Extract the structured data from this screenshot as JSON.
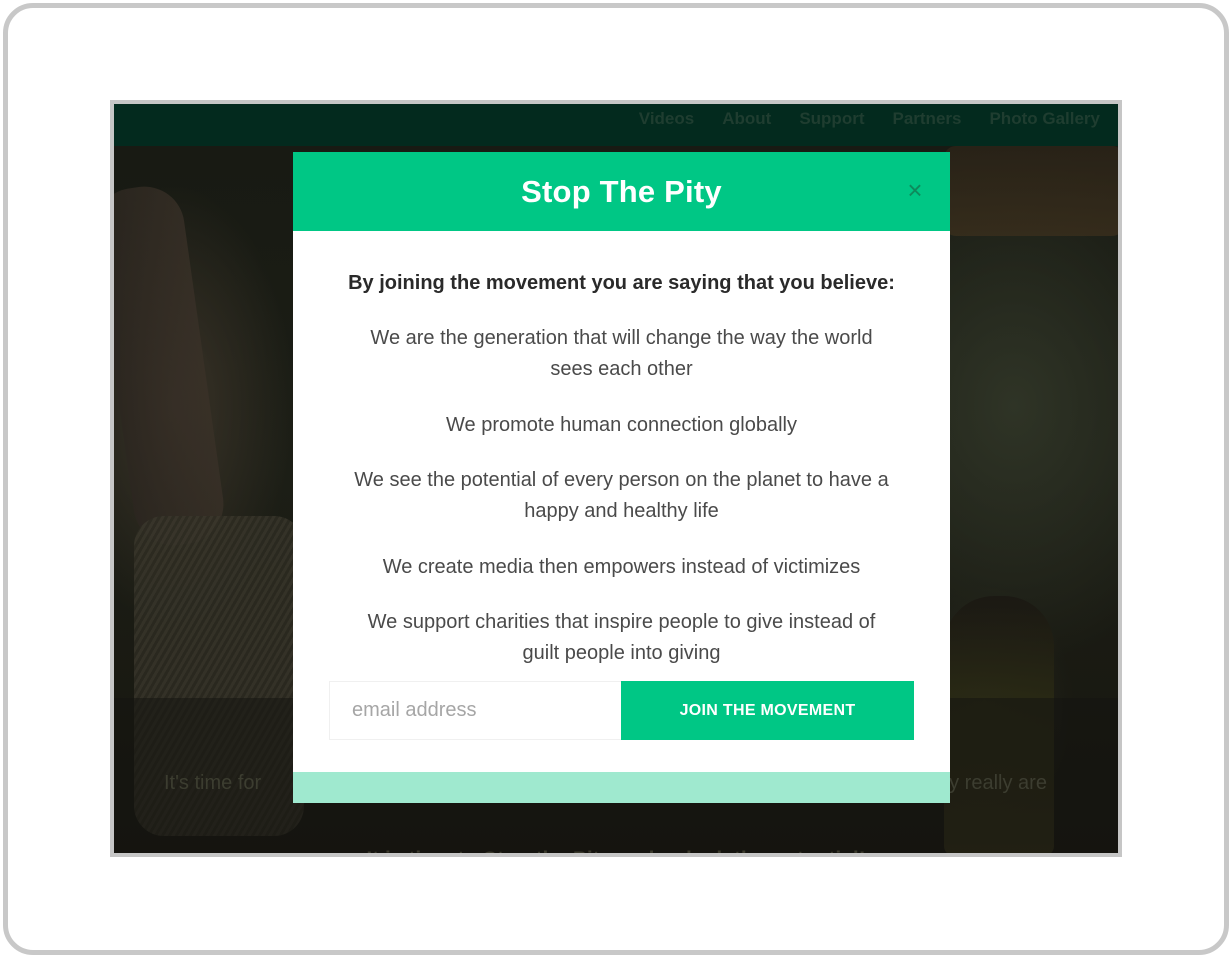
{
  "site": {
    "nav_items": [
      "Videos",
      "About",
      "Support",
      "Partners",
      "Photo Gallery"
    ],
    "hero": {
      "subtext_left": "It's time for",
      "subtext_right": "ey really are",
      "tagline": "It is time to Stop the Pity and unlock the potential!"
    }
  },
  "modal": {
    "title": "Stop The Pity",
    "close_glyph": "×",
    "lead": "By joining the movement you are saying that you believe:",
    "beliefs": [
      "We are the generation that will change the way the world sees each other",
      "We promote human connection globally",
      "We see the potential of every person on the planet to have a happy and healthy life",
      "We create media then empowers instead of victimizes",
      "We support charities that inspire people to give instead of guilt people into giving"
    ],
    "email": {
      "placeholder": "email address",
      "value": ""
    },
    "join_label": "JOIN THE MOVEMENT"
  },
  "colors": {
    "accent": "#00c785",
    "footer_bar": "#9fe9cf",
    "nav_bg": "#032a1e"
  }
}
